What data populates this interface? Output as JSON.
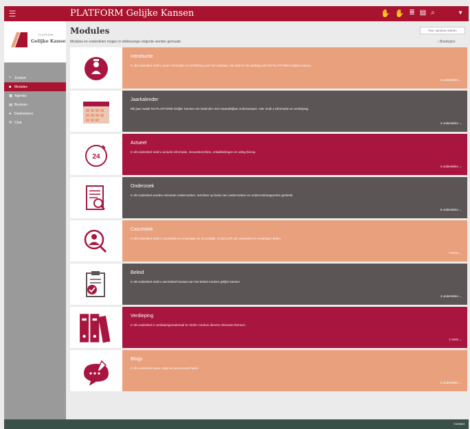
{
  "app": {
    "title": "PLATFORM Gelijke Kansen",
    "menu_icon": "hamburger-icon"
  },
  "brand": {
    "small": "PLATFORM",
    "name": "Gelijke Kansen",
    "colors": {
      "crimson": "#a8132f",
      "salmon": "#e9a07c",
      "gray": "#5c5556"
    }
  },
  "sidebar": {
    "items": [
      {
        "icon": "search-icon",
        "label": "Zoeken"
      },
      {
        "icon": "modules-icon",
        "label": "Modules"
      },
      {
        "icon": "agenda-icon",
        "label": "Agenda"
      },
      {
        "icon": "bronnen-icon",
        "label": "Bronnen"
      },
      {
        "icon": "user-icon",
        "label": "Deelnemers"
      },
      {
        "icon": "chat-icon",
        "label": "Chat"
      }
    ]
  },
  "header": {
    "title": "Modules",
    "subtitle": "Modules en onderdelen mogen in willekeurige volgorde worden gemaakt.",
    "tour": "Tour opnieuw starten",
    "bookmark": "Bladwijzer"
  },
  "modules": [
    {
      "title": "Introductie",
      "desc": "In dit onderdeel vindt u meer informatie en toelichting over het ontstaan, het doel en de werking van het PLATFORM Gelijke Kansen.",
      "count": "5 onderdelen",
      "icon": "person-info-icon"
    },
    {
      "title": "Jaarkalender",
      "desc": "Elk jaar maakt het PLATFORM Gelijke Kansen een kalender met maandelijkse onderwerpen. Hier vindt u informatie en verdieping.",
      "count": "4 onderdelen",
      "icon": "calendar-icon"
    },
    {
      "title": "Actueel",
      "desc": "In dit onderdeel vindt u actuele informatie, nieuwsberichten, ontwikkelingen en uitleg hierop.",
      "count": "4 onderdelen",
      "icon": "clock-24-icon"
    },
    {
      "title": "Onderzoek",
      "desc": "In dit onderdeel worden relevante onderzoeken, inzichten op basis van onderzoeken en onderzoeksrapporten gedeeld.",
      "count": "6 onderdelen",
      "icon": "document-search-icon"
    },
    {
      "title": "Casuïstiek",
      "desc": "In dit onderdeel vindt u casuïstiek en ervaringen uit de praktijk. U kunt zelf ook casuïstiek en ervaringen delen.",
      "count": "7 items",
      "icon": "person-search-icon"
    },
    {
      "title": "Beleid",
      "desc": "In dit onderdeel vindt u wat beleid bestaat aan het beleid rondom gelijke kansen.",
      "count": "4 onderdelen",
      "icon": "clipboard-check-icon"
    },
    {
      "title": "Verdieping",
      "desc": "In dit onderdeel is verdiepingsmateriaal te vinden rondom diverse relevante thema's.",
      "count": "1 serie",
      "icon": "binders-icon"
    },
    {
      "title": "Blogs",
      "desc": "In dit onderdeel staan vlogs en persoonsverhalen.",
      "count": "5 onderdelen",
      "icon": "chat-bubble-icon"
    }
  ],
  "footer": {
    "label": "Contact"
  }
}
